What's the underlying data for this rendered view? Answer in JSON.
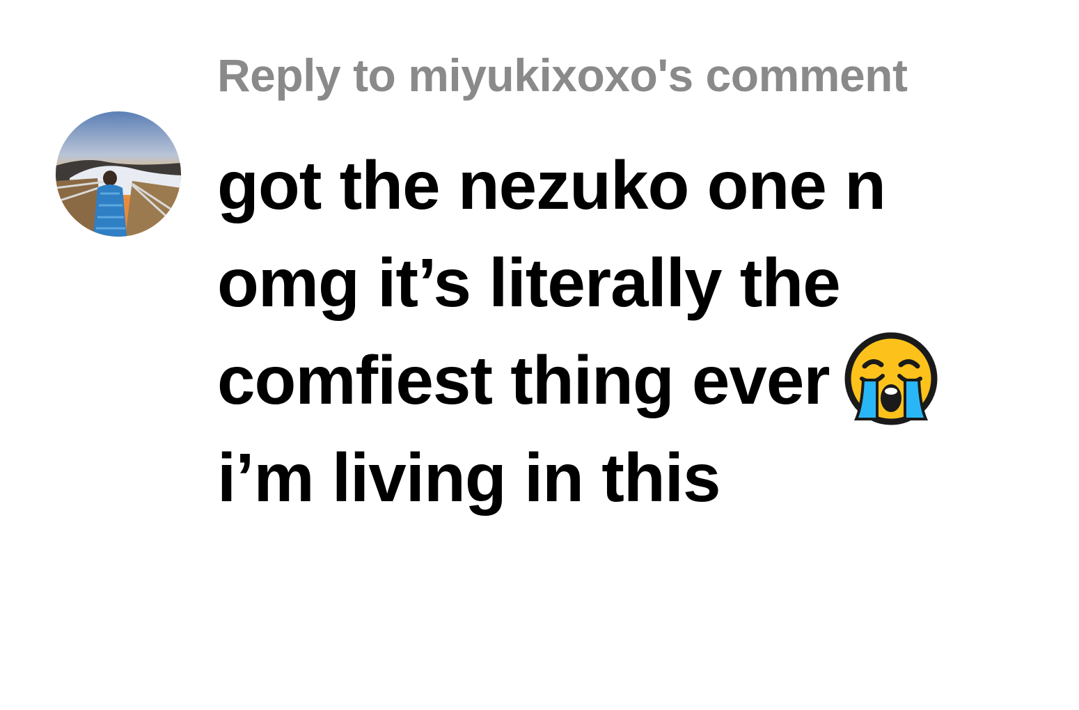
{
  "reply": {
    "label": "Reply to miyukixoxo's comment"
  },
  "avatar": {
    "icon": "user-avatar-photo"
  },
  "comment": {
    "lines": [
      "got the nezuko one n",
      "omg it’s literally the",
      "comfiest thing ever",
      "i’m living in this"
    ],
    "emoji": "loudly-crying-face-emoji"
  },
  "colors": {
    "reply_text": "#8a8a8a",
    "comment_text": "#000000",
    "background": "#ffffff",
    "emoji_face": "#fcc21b",
    "emoji_tears": "#29b6f6"
  }
}
